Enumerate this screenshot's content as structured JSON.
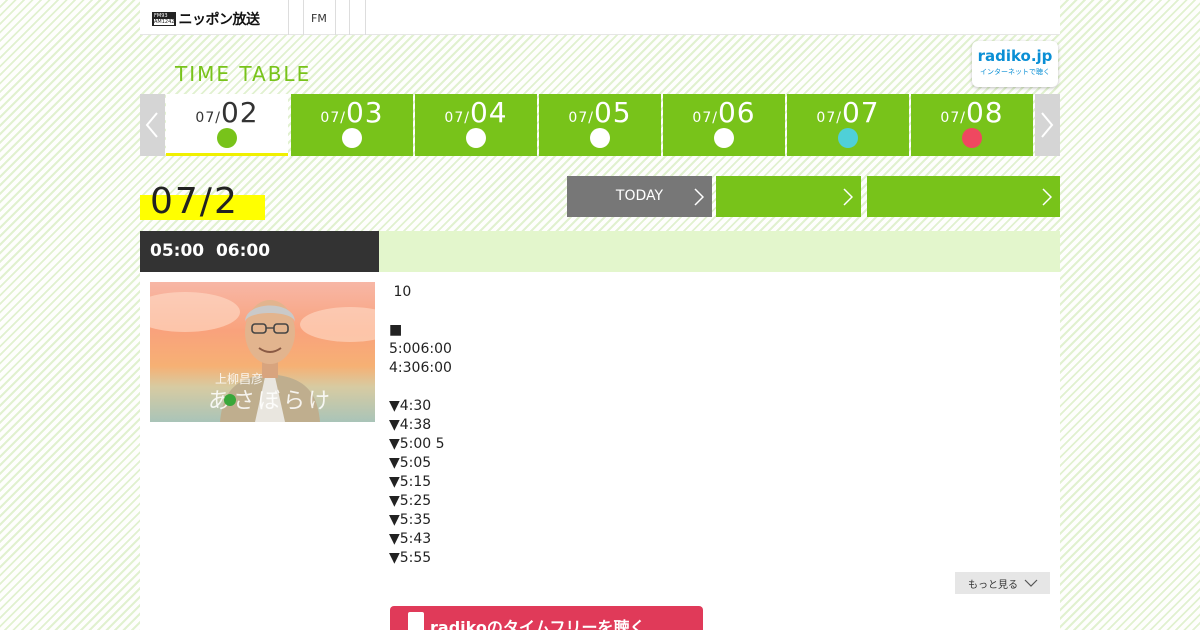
{
  "header": {
    "logo_badge_top": "FM93",
    "logo_badge_bottom": "AM1242",
    "logo_text": "ニッポン放送",
    "nav": [
      "FM"
    ]
  },
  "timetable": {
    "title": "TIME TABLE",
    "radiko_name": "radiko.jp",
    "radiko_tagline": "インターネットで聴く"
  },
  "days": [
    {
      "month": "07/",
      "day": "02",
      "dot_color": "#78c31a",
      "active": true
    },
    {
      "month": "07/",
      "day": "03",
      "dot_color": "#ffffff",
      "active": false
    },
    {
      "month": "07/",
      "day": "04",
      "dot_color": "#ffffff",
      "active": false
    },
    {
      "month": "07/",
      "day": "05",
      "dot_color": "#ffffff",
      "active": false
    },
    {
      "month": "07/",
      "day": "06",
      "dot_color": "#ffffff",
      "active": false
    },
    {
      "month": "07/",
      "day": "07",
      "dot_color": "#4fd0d8",
      "active": false
    },
    {
      "month": "07/",
      "day": "08",
      "dot_color": "#ef4860",
      "active": false
    }
  ],
  "selected_date": "07/2",
  "nav_buttons": {
    "today": "TODAY",
    "prev_day": "",
    "next_day": ""
  },
  "program": {
    "time": "05:00  06:00",
    "title": "",
    "thumb_caption_small": "上柳昌彦",
    "thumb_caption_large": "あさぼらけ",
    "lines": [
      " 10",
      "",
      "■",
      "5:006:00",
      "4:306:00",
      "",
      "▼4:30",
      "▼4:38",
      "▼5:00 5",
      "▼5:05",
      "▼5:15",
      "▼5:25",
      "▼5:35",
      "▼5:43",
      "▼5:55"
    ],
    "more_label": "もっと見る",
    "radiko_button_label": "radikoのタイムフリーを聴く"
  },
  "colors": {
    "brand_green": "#78c31a",
    "today_gray": "#777777",
    "radiko_red": "#e03a59",
    "highlight_yellow": "#ffff00"
  }
}
